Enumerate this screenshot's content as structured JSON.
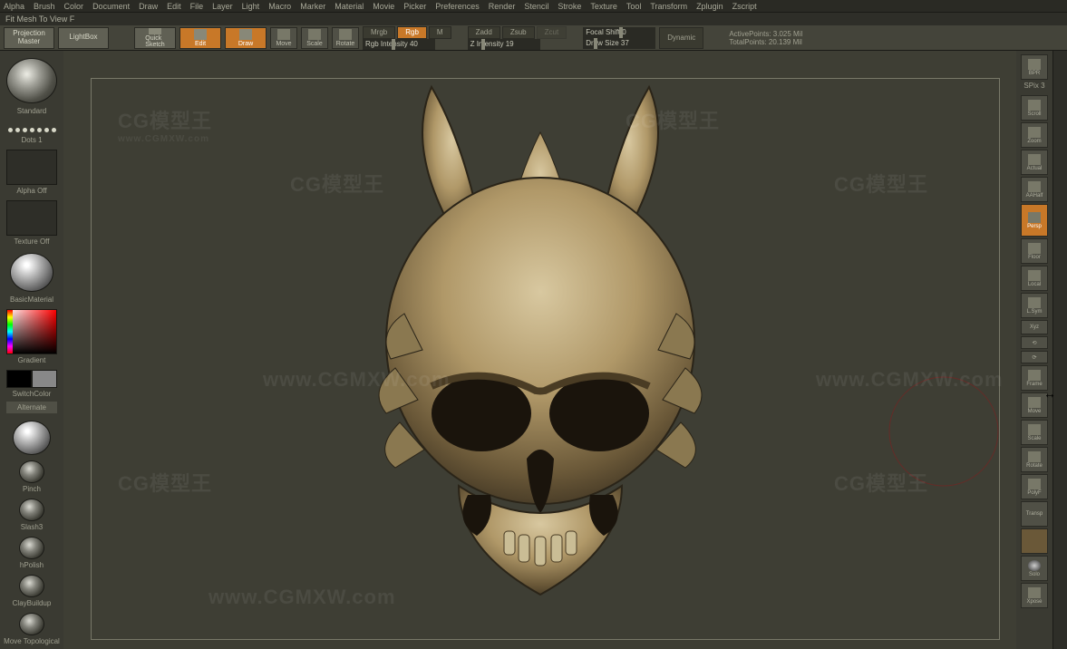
{
  "menu": [
    "Alpha",
    "Brush",
    "Color",
    "Document",
    "Draw",
    "Edit",
    "File",
    "Layer",
    "Light",
    "Macro",
    "Marker",
    "Material",
    "Movie",
    "Picker",
    "Preferences",
    "Render",
    "Stencil",
    "Stroke",
    "Texture",
    "Tool",
    "Transform",
    "Zplugin",
    "Zscript"
  ],
  "hint": "Fit Mesh To View  F",
  "toolbar": {
    "projection_master": "Projection\nMaster",
    "lightbox": "LightBox",
    "quick_sketch": "Quick\nSketch",
    "edit": "Edit",
    "draw": "Draw",
    "move": "Move",
    "scale": "Scale",
    "rotate": "Rotate",
    "modes": {
      "mrgb": "Mrgb",
      "rgb": "Rgb",
      "m": "M"
    },
    "rgb_intensity_label": "Rgb Intensity",
    "rgb_intensity_val": "40",
    "zadd": "Zadd",
    "zsub": "Zsub",
    "zcut": "Zcut",
    "z_intensity_label": "Z Intensity",
    "z_intensity_val": "19",
    "focal_shift_label": "Focal Shift",
    "focal_shift_val": "0",
    "draw_size_label": "Draw Size",
    "draw_size_val": "37",
    "dynamic": "Dynamic",
    "active_points_label": "ActivePoints:",
    "active_points_val": "3.025 Mil",
    "total_points_label": "TotalPoints:",
    "total_points_val": "20.139 Mil"
  },
  "left": {
    "brush_name": "Standard",
    "stroke_name": "Dots 1",
    "alpha_off": "Alpha Off",
    "texture_off": "Texture Off",
    "material": "BasicMaterial",
    "gradient": "Gradient",
    "switch_color": "SwitchColor",
    "alternate": "Alternate",
    "brushes": [
      "Pinch",
      "Slash3",
      "hPolish",
      "ClayBuildup",
      "Move Topological"
    ]
  },
  "right": {
    "bpr": "BPR",
    "spix_label": "SPix",
    "spix_val": "3",
    "scroll": "Scroll",
    "zoom": "Zoom",
    "actual": "Actual",
    "aahalf": "AAHalf",
    "persp": "Persp",
    "floor": "Floor",
    "local": "Local",
    "lsym": "L.Sym",
    "xyz": "Xyz",
    "frame": "Frame",
    "move": "Move",
    "scale": "Scale",
    "rotate": "Rotate",
    "polyf": "PolyF",
    "transp": "Transp",
    "solo": "Solo",
    "xpose": "Xpose"
  },
  "watermark": "CG模型王",
  "watermark_sub": "www.CGMXW.com"
}
